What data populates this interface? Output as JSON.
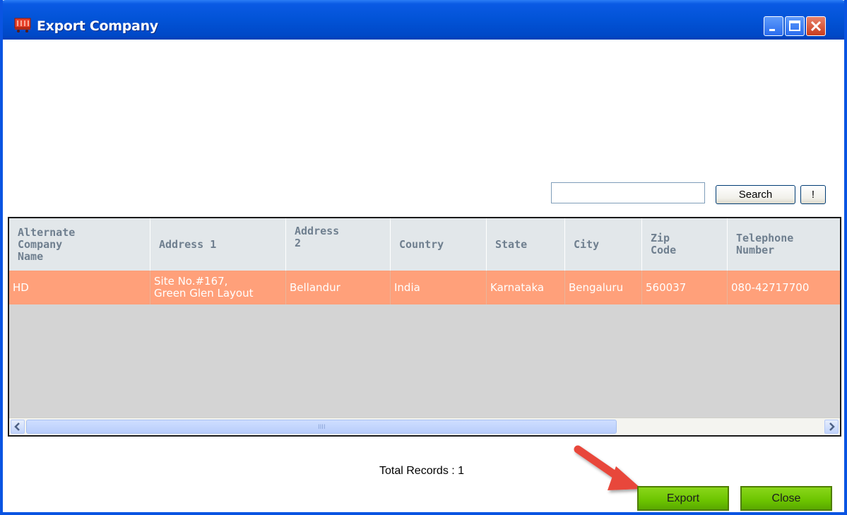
{
  "window": {
    "title": "Export Company",
    "icon": "cart-icon"
  },
  "search": {
    "value": "",
    "button_label": "Search",
    "reset_label": "!"
  },
  "grid": {
    "columns": [
      "Alternate\nCompany\nName",
      "Address 1",
      "Address\n2",
      "Country",
      "State",
      "City",
      "Zip\nCode",
      "Telephone\nNumber"
    ],
    "rows": [
      {
        "alt_name": "HD",
        "address1": "Site No.#167,\nGreen Glen Layout",
        "address2": "Bellandur",
        "country": "India",
        "state": "Karnataka",
        "city": "Bengaluru",
        "zip": "560037",
        "telephone": "080-42717700"
      }
    ],
    "scroll_grip": "IIII"
  },
  "footer": {
    "total_records": "Total Records : 1",
    "export_label": "Export",
    "close_label": "Close"
  },
  "colors": {
    "titlebar": "#0253d6",
    "selected_row": "#ffa07a",
    "header_bg": "#e2e7ea",
    "action_button": "#6cc400",
    "annotation_arrow": "#e8473a"
  }
}
